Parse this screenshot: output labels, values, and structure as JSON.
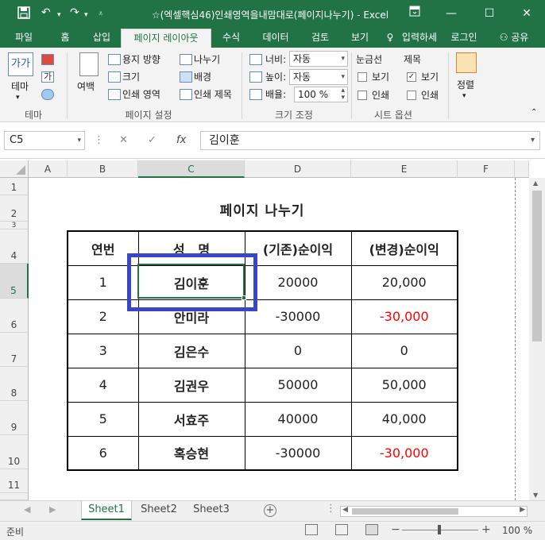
{
  "titlebar": {
    "title": "☆(엑셀핵심46)인쇄영역을내맘대로(페이지나누기) - Excel",
    "save_icon": "save-icon",
    "undo_icon": "undo-icon",
    "redo_icon": "redo-icon",
    "ribbon_display_icon": "ribbon-display-icon",
    "bg_color": "#217346"
  },
  "tabs": [
    {
      "label": "파일"
    },
    {
      "label": "홈"
    },
    {
      "label": "삽입"
    },
    {
      "label": "페이지 레이아웃"
    },
    {
      "label": "수식"
    },
    {
      "label": "데이터"
    },
    {
      "label": "검토"
    },
    {
      "label": "보기"
    },
    {
      "label": "입력하세"
    },
    {
      "label": "로그인"
    },
    {
      "label": "공유"
    }
  ],
  "ribbon": {
    "theme": {
      "label": "테마",
      "icon_text": "가가",
      "colors_icon": "colors-icon",
      "fonts_icon_text": "가",
      "effects_icon": "effects-icon",
      "group": "테마"
    },
    "page_setup": {
      "margins": "여백",
      "orientation": "용지 방향",
      "size": "크기",
      "print_area": "인쇄 영역",
      "breaks": "나누기",
      "background": "배경",
      "print_titles": "인쇄 제목",
      "group": "페이지 설정"
    },
    "scale": {
      "width_label": "너비:",
      "width_value": "자동",
      "height_label": "높이:",
      "height_value": "자동",
      "scale_label": "배율:",
      "scale_value": "100 %",
      "group": "크기 조정"
    },
    "sheet_options": {
      "gridlines": "눈금선",
      "headings": "제목",
      "view": "보기",
      "print": "인쇄",
      "gridlines_view": false,
      "gridlines_print": false,
      "headings_view": true,
      "headings_print": false,
      "group": "시트 옵션"
    },
    "arrange": {
      "label": "정렬"
    }
  },
  "formula_bar": {
    "name_box": "C5",
    "fx": "fx",
    "content": "김이훈"
  },
  "grid": {
    "columns": [
      "A",
      "B",
      "C",
      "D",
      "E",
      "F"
    ],
    "selected_column": "C",
    "rows": [
      "1",
      "2",
      "3",
      "4",
      "5",
      "6",
      "7",
      "8",
      "9",
      "10",
      "11"
    ],
    "selected_row": "5"
  },
  "sheet_content": {
    "title": "페이지 나누기",
    "headers": [
      "연번",
      "성   명",
      "(기존)순이익",
      "(변경)순이익"
    ],
    "rows": [
      {
        "no": "1",
        "name": "김이훈",
        "old": "20000",
        "new": "20,000",
        "negative": false
      },
      {
        "no": "2",
        "name": "안미라",
        "old": "-30000",
        "new": "-30,000",
        "negative": true
      },
      {
        "no": "3",
        "name": "김은수",
        "old": "0",
        "new": "0",
        "negative": false
      },
      {
        "no": "4",
        "name": "김권우",
        "old": "50000",
        "new": "50,000",
        "negative": false
      },
      {
        "no": "5",
        "name": "서효주",
        "old": "40000",
        "new": "40,000",
        "negative": false
      },
      {
        "no": "6",
        "name": "혹승현",
        "old": "-30000",
        "new": "-30,000",
        "negative": true
      }
    ],
    "negative_color": "#ff0000"
  },
  "sheets": [
    {
      "label": "Sheet1",
      "active": true
    },
    {
      "label": "Sheet2",
      "active": false
    },
    {
      "label": "Sheet3",
      "active": false
    }
  ],
  "statusbar": {
    "status": "준비",
    "zoom": "100 %"
  }
}
